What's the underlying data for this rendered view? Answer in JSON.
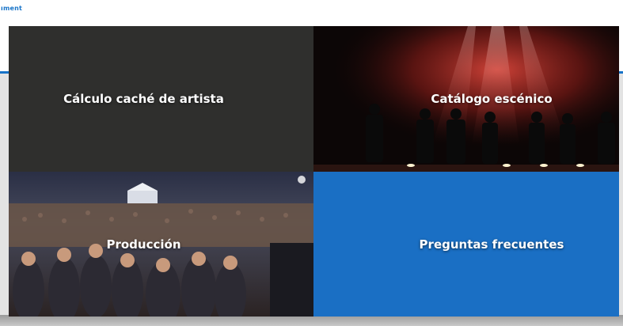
{
  "logo": {
    "text": "ıment",
    "color": "#1773c8"
  },
  "tiles": [
    {
      "label": "Cálculo caché de artista",
      "bg": "#2f2f2d"
    },
    {
      "label": "Catálogo escénico",
      "bg": "#0c0606"
    },
    {
      "label": "Producción",
      "bg": "#1d1f2c"
    },
    {
      "label": "Preguntas frecuentes",
      "bg": "#1a6fc4"
    }
  ],
  "accent_color": "#1773c8"
}
